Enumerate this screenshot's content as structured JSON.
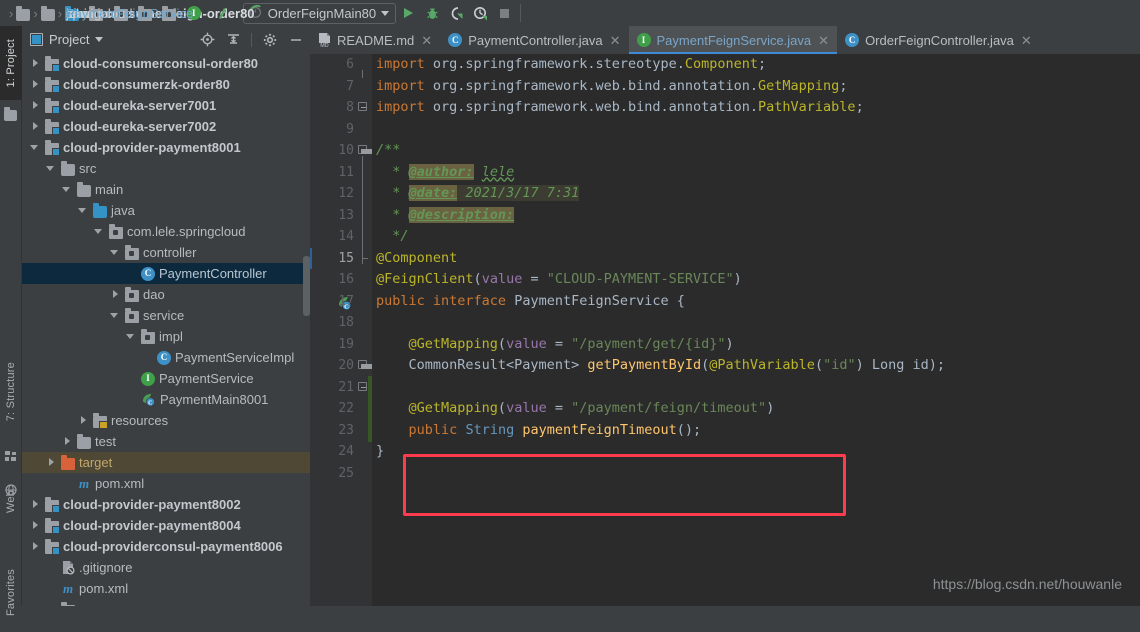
{
  "navbar": {
    "breadcrumbs": [
      {
        "label": "cloud-consumer-feign-order80",
        "icon": "none",
        "kind": "root"
      },
      {
        "label": "src",
        "icon": "folder-icon",
        "kind": "folder"
      },
      {
        "label": "main",
        "icon": "folder-icon",
        "kind": "folder"
      },
      {
        "label": "java",
        "icon": "folder-blue-icon",
        "kind": "source-folder"
      },
      {
        "label": "com",
        "icon": "package-icon",
        "kind": "package"
      },
      {
        "label": "lele",
        "icon": "package-icon",
        "kind": "package"
      },
      {
        "label": "springcloud",
        "icon": "package-icon",
        "kind": "package"
      },
      {
        "label": "service",
        "icon": "package-icon",
        "kind": "package"
      },
      {
        "label": "PaymentFeignService",
        "icon": "interface-icon",
        "kind": "interface"
      }
    ],
    "separator": "›",
    "back_icon": "navigate-up-arrow-icon",
    "run_config": {
      "name": "OrderFeignMain80",
      "icon": "spring-boot-icon"
    },
    "toolbar_buttons": [
      {
        "name": "run-button",
        "icon": "play-icon",
        "color": "#59a869"
      },
      {
        "name": "debug-button",
        "icon": "bug-icon",
        "color": "#59a869"
      },
      {
        "name": "run-with-coverage-button",
        "icon": "coverage-icon",
        "color": "#d0d3d6"
      },
      {
        "name": "profile-button",
        "icon": "profiler-icon",
        "color": "#d0d3d6"
      },
      {
        "name": "stop-button",
        "icon": "stop-square-icon",
        "color": "#7b7f82"
      }
    ]
  },
  "toolwindow_bar": [
    {
      "label": "1: Project",
      "active": true
    },
    {
      "label": "7: Structure",
      "active": false
    },
    {
      "label": "Web",
      "active": false
    },
    {
      "label": "Favorites",
      "active": false
    }
  ],
  "project_panel": {
    "title": "Project",
    "header_icons": [
      "locate-target-icon",
      "collapse-all-icon",
      "settings-gear-icon",
      "minimize-icon"
    ],
    "tree": [
      {
        "label": "cloud-consumerconsul-order80",
        "indent": 1,
        "arrow": "right",
        "icon": "module-icon",
        "style": "module"
      },
      {
        "label": "cloud-consumerzk-order80",
        "indent": 1,
        "arrow": "right",
        "icon": "module-icon",
        "style": "module"
      },
      {
        "label": "cloud-eureka-server7001",
        "indent": 1,
        "arrow": "right",
        "icon": "module-icon",
        "style": "module"
      },
      {
        "label": "cloud-eureka-server7002",
        "indent": 1,
        "arrow": "right",
        "icon": "module-icon",
        "style": "module"
      },
      {
        "label": "cloud-provider-payment8001",
        "indent": 1,
        "arrow": "down",
        "icon": "module-icon",
        "style": "module"
      },
      {
        "label": "src",
        "indent": 2,
        "arrow": "down",
        "icon": "folder-icon",
        "style": "plain"
      },
      {
        "label": "main",
        "indent": 3,
        "arrow": "down",
        "icon": "folder-icon",
        "style": "plain"
      },
      {
        "label": "java",
        "indent": 4,
        "arrow": "down",
        "icon": "folder-blue-icon",
        "style": "plain"
      },
      {
        "label": "com.lele.springcloud",
        "indent": 5,
        "arrow": "down",
        "icon": "package-icon",
        "style": "plain"
      },
      {
        "label": "controller",
        "indent": 6,
        "arrow": "down",
        "icon": "package-icon",
        "style": "plain"
      },
      {
        "label": "PaymentController",
        "indent": 7,
        "arrow": "none",
        "icon": "class-icon",
        "style": "selected"
      },
      {
        "label": "dao",
        "indent": 6,
        "arrow": "right",
        "icon": "package-icon",
        "style": "plain"
      },
      {
        "label": "service",
        "indent": 6,
        "arrow": "down",
        "icon": "package-icon",
        "style": "plain"
      },
      {
        "label": "impl",
        "indent": 7,
        "arrow": "down",
        "icon": "package-icon",
        "style": "plain"
      },
      {
        "label": "PaymentServiceImpl",
        "indent": 8,
        "arrow": "none",
        "icon": "class-icon",
        "style": "plain"
      },
      {
        "label": "PaymentService",
        "indent": 7,
        "arrow": "none",
        "icon": "interface-icon",
        "style": "plain"
      },
      {
        "label": "PaymentMain8001",
        "indent": 7,
        "arrow": "none",
        "icon": "spring-class-icon",
        "style": "plain"
      },
      {
        "label": "resources",
        "indent": 4,
        "arrow": "right",
        "icon": "resources-icon",
        "style": "plain"
      },
      {
        "label": "test",
        "indent": 3,
        "arrow": "right",
        "icon": "folder-icon",
        "style": "plain"
      },
      {
        "label": "target",
        "indent": 2,
        "arrow": "right",
        "icon": "target-folder-icon",
        "style": "target"
      },
      {
        "label": "pom.xml",
        "indent": 3,
        "arrow": "none",
        "icon": "maven-icon",
        "style": "plain"
      },
      {
        "label": "cloud-provider-payment8002",
        "indent": 1,
        "arrow": "right",
        "icon": "module-icon",
        "style": "module"
      },
      {
        "label": "cloud-provider-payment8004",
        "indent": 1,
        "arrow": "right",
        "icon": "module-icon",
        "style": "module"
      },
      {
        "label": "cloud-providerconsul-payment8006",
        "indent": 1,
        "arrow": "right",
        "icon": "module-icon",
        "style": "module"
      },
      {
        "label": ".gitignore",
        "indent": 2,
        "arrow": "none",
        "icon": "gitignore-icon",
        "style": "plain"
      },
      {
        "label": "pom.xml",
        "indent": 2,
        "arrow": "none",
        "icon": "maven-icon",
        "style": "plain"
      },
      {
        "label": "",
        "indent": 2,
        "arrow": "none",
        "icon": "module-icon",
        "style": "plain"
      }
    ]
  },
  "editor_tabs": [
    {
      "label": "README.md",
      "icon": "markdown-icon",
      "active": false,
      "close": "✕"
    },
    {
      "label": "PaymentController.java",
      "icon": "class-icon",
      "active": false,
      "close": "✕"
    },
    {
      "label": "PaymentFeignService.java",
      "icon": "interface-icon",
      "active": true,
      "close": "✕"
    },
    {
      "label": "OrderFeignController.java",
      "icon": "class-icon",
      "active": false,
      "close": "✕"
    }
  ],
  "code": {
    "first_line_number": 6,
    "lines": [
      {
        "n": 6,
        "html": "<span class='kw'>import</span> <span class='txt'>org.springframework.stereotype.</span><span class='ann'>Component</span><span class='txt'>;</span>"
      },
      {
        "n": 7,
        "html": "<span class='kw'>import</span> <span class='txt'>org.springframework.web.bind.annotation.</span><span class='ann'>GetMapping</span><span class='txt'>;</span>"
      },
      {
        "n": 8,
        "html": "<span class='kw'>import</span> <span class='txt'>org.springframework.web.bind.annotation.</span><span class='ann'>PathVariable</span><span class='txt'>;</span>"
      },
      {
        "n": 9,
        "html": ""
      },
      {
        "n": 10,
        "html": "<span class='cmt'>/**</span>"
      },
      {
        "n": 11,
        "html": "<span class='cmt'>  * </span><span class='cmt-tag'>@author:</span><span class='cmt'> </span><span class='cmt squig'>lele</span>"
      },
      {
        "n": 12,
        "html": "<span class='cmt'>  * </span><span class='cmt-tag'>@date:</span><span class='cmt-val'> 2021/3/17 7:31</span>"
      },
      {
        "n": 13,
        "html": "<span class='cmt'>  * </span><span class='cmt-tag'>@description:</span>"
      },
      {
        "n": 14,
        "html": "<span class='cmt'>  */</span>"
      },
      {
        "n": 15,
        "html": "<span class='ann'>@Component</span>"
      },
      {
        "n": 16,
        "html": "<span class='ann'>@FeignClient</span><span class='txt'>(</span><span class='fld'>value</span> <span class='txt'>= </span><span class='str'>\"CLOUD-PAYMENT-SERVICE\"</span><span class='txt'>)</span>"
      },
      {
        "n": 17,
        "html": "<span class='kw'>public interface</span> <span class='txt'>PaymentFeignService {</span>"
      },
      {
        "n": 18,
        "html": ""
      },
      {
        "n": 19,
        "html": "    <span class='ann'>@GetMapping</span><span class='txt'>(</span><span class='fld'>value</span> <span class='txt'>= </span><span class='str'>\"/payment/get/{id}\"</span><span class='txt'>)</span>"
      },
      {
        "n": 20,
        "html": "    <span class='txt'>CommonResult&lt;Payment&gt; </span><span class='mname'>getPaymentById</span><span class='txt'>(</span><span class='ann'>@PathVariable</span><span class='txt'>(</span><span class='str'>\"id\"</span><span class='txt'>) Long id);</span>"
      },
      {
        "n": 21,
        "html": ""
      },
      {
        "n": 22,
        "html": "    <span class='ann'>@GetMapping</span><span class='txt'>(</span><span class='fld'>value</span> <span class='txt'>= </span><span class='str'>\"/payment/feign/timeout\"</span><span class='txt'>)</span>"
      },
      {
        "n": 23,
        "html": "    <span class='kw'>public</span> <span class='num'>String</span> <span class='mname'>paymentFeignTimeout</span><span class='txt'>();</span>"
      },
      {
        "n": 24,
        "html": "<span class='txt'>}</span>"
      },
      {
        "n": 25,
        "html": ""
      }
    ],
    "current_line": 15,
    "annotation_box": {
      "name": "red-highlight-box",
      "color": "#ff3b4e"
    },
    "gutter_implement_icon_line": 17,
    "vcs_change_lines": [
      21,
      22,
      23
    ]
  },
  "watermark": "https://blog.csdn.net/houwanle"
}
